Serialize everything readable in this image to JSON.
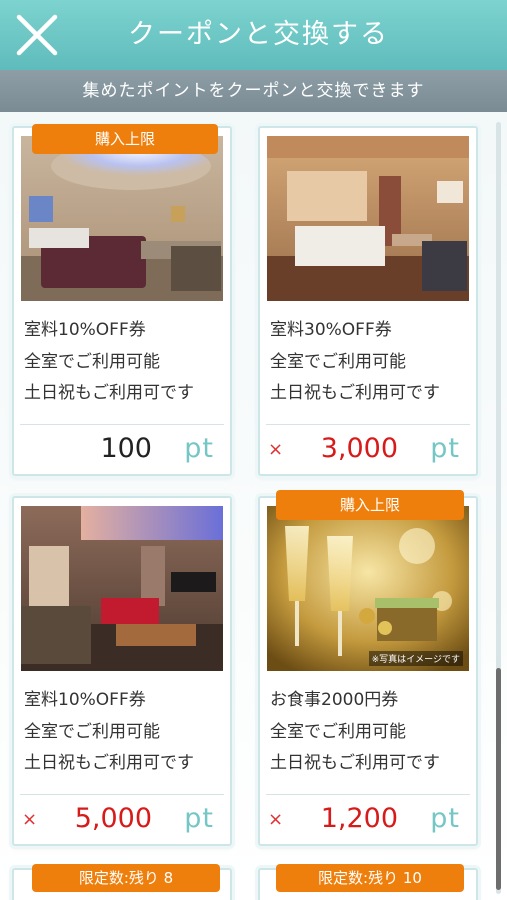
{
  "header": {
    "title": "クーポンと交換する",
    "close_icon": "close-x-icon"
  },
  "subheader": {
    "text": "集めたポイントをクーポンと交換できます"
  },
  "colors": {
    "header_teal": "#6cc8c6",
    "subbar_gray": "#869aa2",
    "badge_orange": "#ef7f0c",
    "price_red": "#d71a1a",
    "pt_teal": "#77c6c6"
  },
  "coupons": [
    {
      "badge": "購入上限",
      "lines": [
        "室料10%OFF券",
        "全室でご利用可能",
        "土日祝もご利用可です"
      ],
      "has_x": false,
      "points": "100",
      "unit": "pt"
    },
    {
      "badge": "",
      "lines": [
        "室料30%OFF券",
        "全室でご利用可能",
        "土日祝もご利用可です"
      ],
      "has_x": true,
      "x_mark": "×",
      "points": "3,000",
      "unit": "pt"
    },
    {
      "badge": "",
      "lines": [
        "室料10%OFF券",
        "全室でご利用可能",
        "土日祝もご利用可です"
      ],
      "has_x": true,
      "x_mark": "×",
      "points": "5,000",
      "unit": "pt"
    },
    {
      "badge": "購入上限",
      "image_note": "※写真はイメージです",
      "lines": [
        "お食事2000円券",
        "全室でご利用可能",
        "土日祝もご利用可です"
      ],
      "has_x": true,
      "x_mark": "×",
      "points": "1,200",
      "unit": "pt"
    }
  ],
  "next_row_badges": [
    "限定数:残り 8",
    "限定数:残り 10"
  ]
}
